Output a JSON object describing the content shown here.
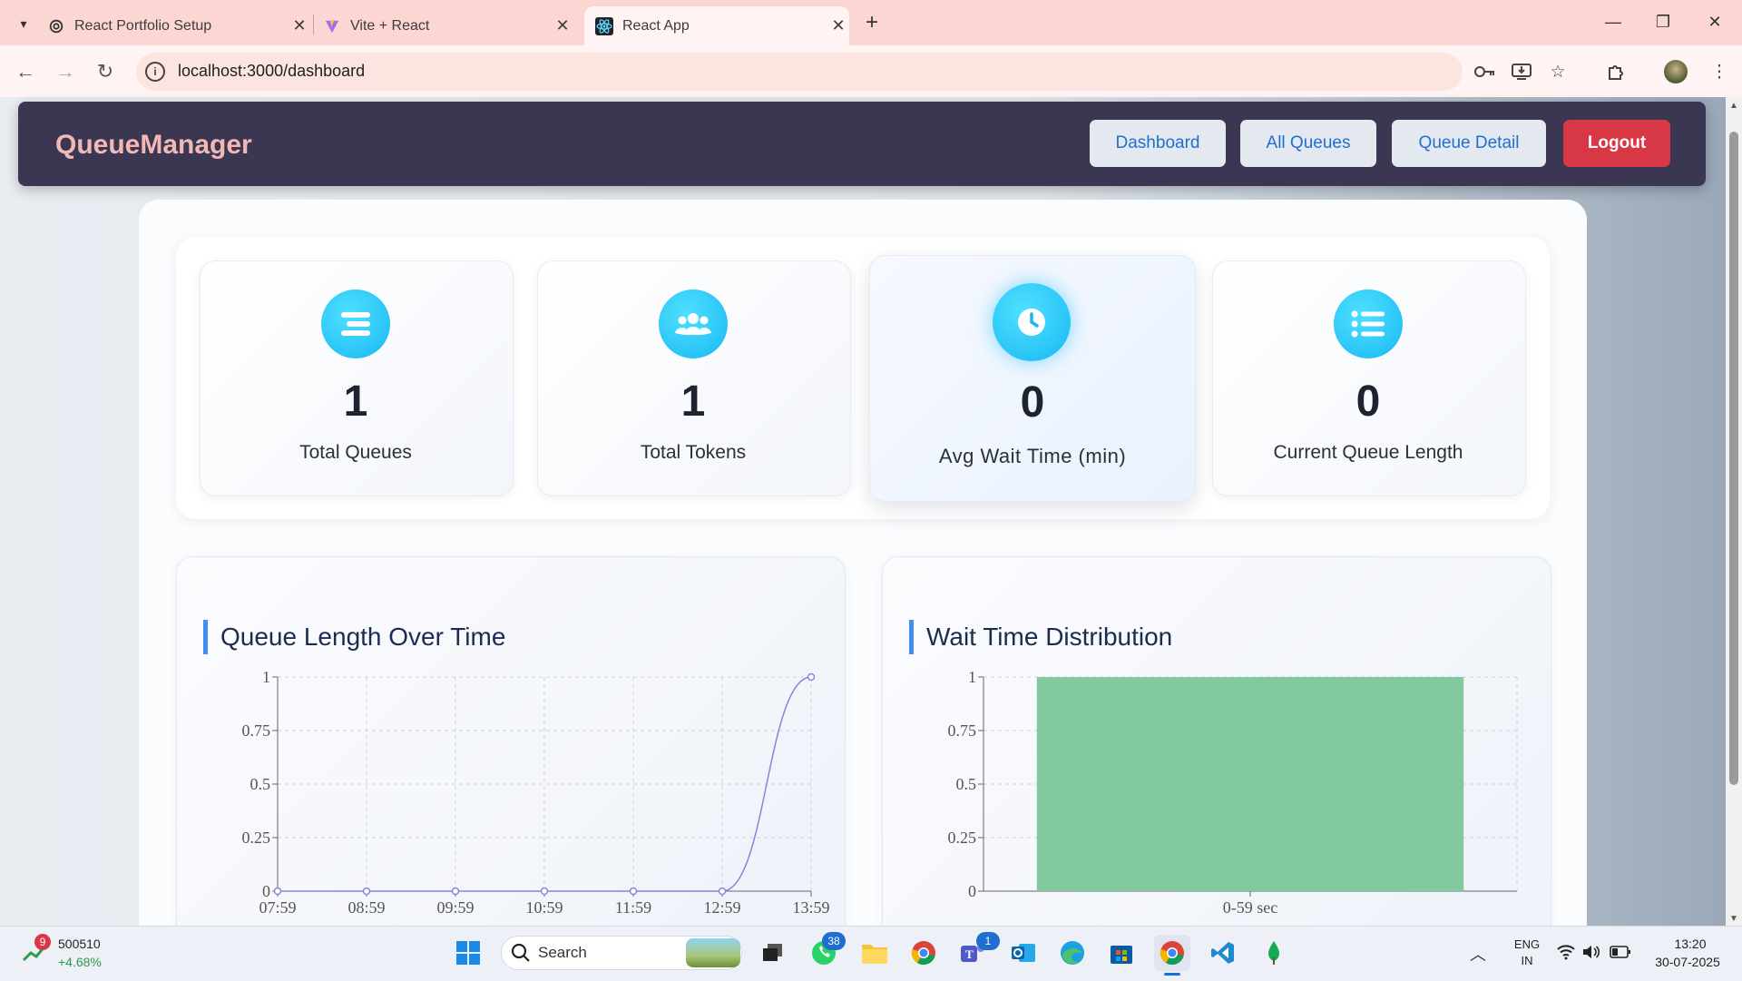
{
  "browser": {
    "tabs": [
      {
        "title": "React Portfolio Setup",
        "icon": "openai-icon"
      },
      {
        "title": "Vite + React",
        "icon": "vite-icon"
      },
      {
        "title": "React App",
        "icon": "react-icon",
        "active": true
      }
    ],
    "url": "localhost:3000/dashboard"
  },
  "navbar": {
    "brand": "QueueManager",
    "links": [
      "Dashboard",
      "All Queues",
      "Queue Detail"
    ],
    "logout": "Logout"
  },
  "stats": [
    {
      "value": "1",
      "label": "Total Queues",
      "icon": "bars-icon"
    },
    {
      "value": "1",
      "label": "Total Tokens",
      "icon": "users-icon"
    },
    {
      "value": "0",
      "label": "Avg Wait Time (min)",
      "icon": "clock-icon"
    },
    {
      "value": "0",
      "label": "Current Queue Length",
      "icon": "list-icon"
    }
  ],
  "charts_titles": [
    "Queue Length Over Time",
    "Wait Time Distribution"
  ],
  "chart_data": [
    {
      "type": "line",
      "title": "Queue Length Over Time",
      "x": [
        "07:59",
        "08:59",
        "09:59",
        "10:59",
        "11:59",
        "12:59",
        "13:59"
      ],
      "series": [
        {
          "values": [
            0,
            0,
            0,
            0,
            0,
            0,
            1
          ]
        }
      ],
      "yticks": [
        "0",
        "0.25",
        "0.5",
        "0.75",
        "1"
      ],
      "ylim": [
        0,
        1
      ],
      "grid": true,
      "color": "#8884d8"
    },
    {
      "type": "bar",
      "title": "Wait Time Distribution",
      "categories": [
        "0-59 sec"
      ],
      "values": [
        1
      ],
      "yticks": [
        "0",
        "0.25",
        "0.5",
        "0.75",
        "1"
      ],
      "ylim": [
        0,
        1
      ],
      "grid": true,
      "color": "#82ca9d"
    }
  ],
  "taskbar": {
    "stock": {
      "name": "500510",
      "change": "+4.68%",
      "badge": "9"
    },
    "search": "Search",
    "whatsapp_badge": "38",
    "teams_badge": "1",
    "lang": {
      "line1": "ENG",
      "line2": "IN"
    },
    "time": "13:20",
    "date": "30-07-2025"
  }
}
